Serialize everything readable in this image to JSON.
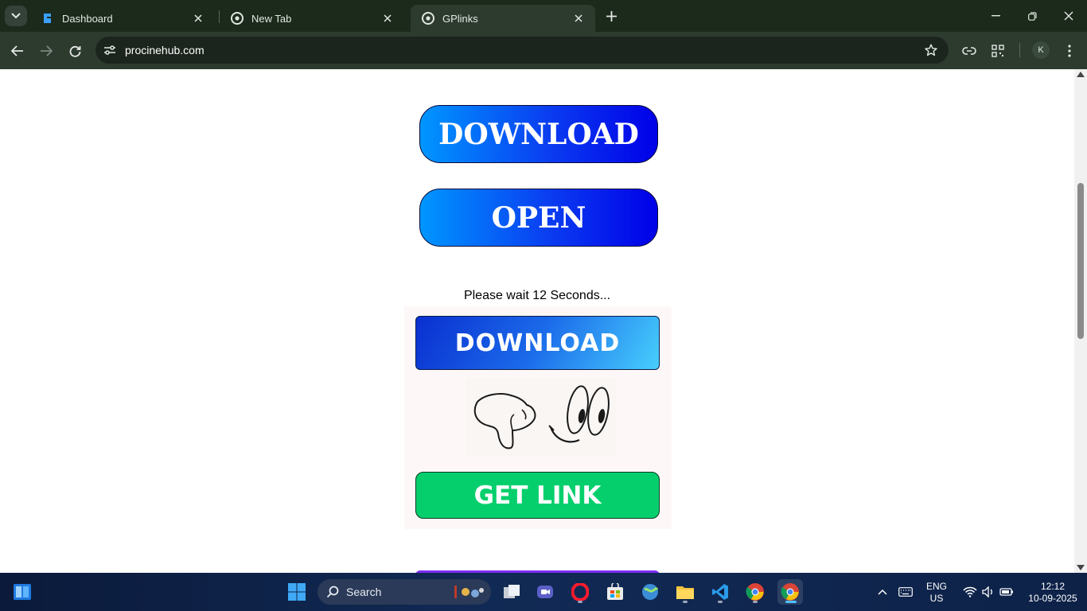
{
  "browser": {
    "tabs": [
      {
        "title": "Dashboard"
      },
      {
        "title": "New Tab"
      },
      {
        "title": "GPlinks"
      }
    ],
    "url": "procinehub.com",
    "profile_initial": "K"
  },
  "page": {
    "download_button": "DOWNLOAD",
    "open_button": "OPEN",
    "wait_message": "Please wait 12 Seconds...",
    "download_button_2": "DOWNLOAD",
    "get_link_button": "GET LINK"
  },
  "taskbar": {
    "search_label": "Search",
    "language": "ENG",
    "region": "US",
    "time": "12:12",
    "date": "10-09-2025",
    "accent": "#4cc2ff"
  }
}
